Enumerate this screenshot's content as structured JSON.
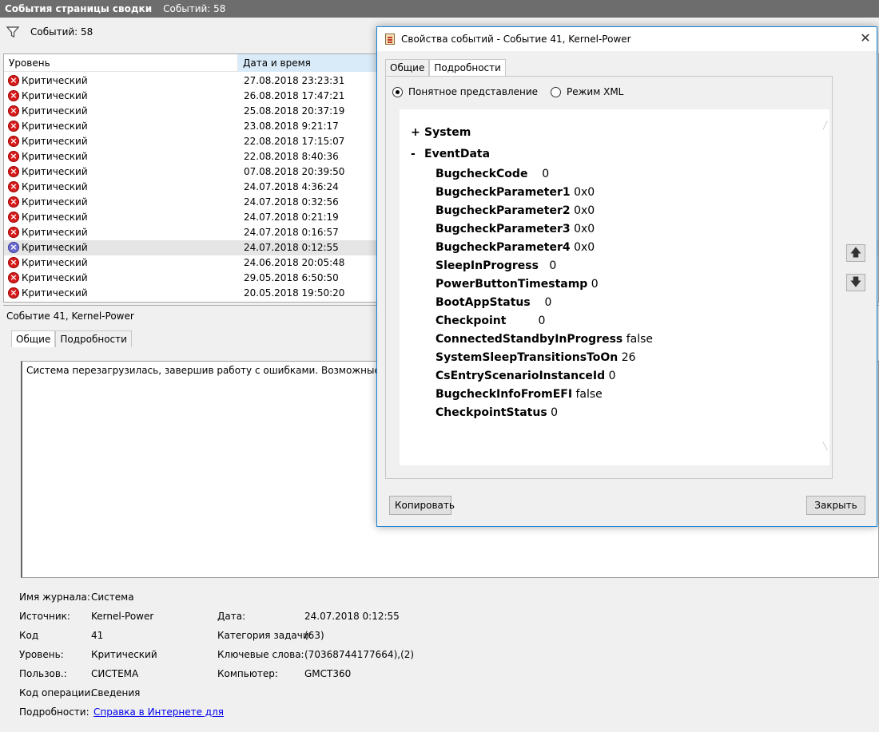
{
  "topbar": {
    "title": "События страницы сводки",
    "count": "Событий: 58"
  },
  "filter": {
    "count": "Событий: 58"
  },
  "table": {
    "columns": {
      "level": "Уровень",
      "date": "Дата и время"
    },
    "rows": [
      {
        "level": "Критический",
        "date": "27.08.2018 23:23:31"
      },
      {
        "level": "Критический",
        "date": "26.08.2018 17:47:21"
      },
      {
        "level": "Критический",
        "date": "25.08.2018 20:37:19"
      },
      {
        "level": "Критический",
        "date": "23.08.2018 9:21:17"
      },
      {
        "level": "Критический",
        "date": "22.08.2018 17:15:07"
      },
      {
        "level": "Критический",
        "date": "22.08.2018 8:40:36"
      },
      {
        "level": "Критический",
        "date": "07.08.2018 20:39:50"
      },
      {
        "level": "Критический",
        "date": "24.07.2018 4:36:24"
      },
      {
        "level": "Критический",
        "date": "24.07.2018 0:32:56"
      },
      {
        "level": "Критический",
        "date": "24.07.2018 0:21:19"
      },
      {
        "level": "Критический",
        "date": "24.07.2018 0:16:57"
      },
      {
        "level": "Критический",
        "date": "24.07.2018 0:12:55",
        "selected": true
      },
      {
        "level": "Критический",
        "date": "24.06.2018 20:05:48"
      },
      {
        "level": "Критический",
        "date": "29.05.2018 6:50:50"
      },
      {
        "level": "Критический",
        "date": "20.05.2018 19:50:20"
      }
    ]
  },
  "lower": {
    "event_header": "Событие 41, Kernel-Power",
    "tabs": {
      "general": "Общие",
      "details": "Подробности"
    },
    "description": "Система перезагрузилась, завершив работу с ошибками. Возможные причины",
    "props": {
      "log_label": "Имя журнала:",
      "log_value": "Система",
      "source_label": "Источник:",
      "source_value": "Kernel-Power",
      "date_label": "Дата:",
      "date_value": "24.07.2018 0:12:55",
      "code_label": "Код",
      "code_value": "41",
      "category_label": "Категория задачи:",
      "category_value": "(63)",
      "level_label": "Уровень:",
      "level_value": "Критический",
      "keywords_label": "Ключевые слова:",
      "keywords_value": "(70368744177664),(2)",
      "user_label": "Пользов.:",
      "user_value": "СИСТЕМА",
      "computer_label": "Компьютер:",
      "computer_value": "GMCT360",
      "opcode_label": "Код операции:",
      "opcode_value": "Сведения",
      "details_label": "Подробности:",
      "details_link": "Справка в Интернете для"
    }
  },
  "dialog": {
    "title": "Свойства событий - Событие 41, Kernel-Power",
    "close_glyph": "✕",
    "tabs": {
      "general": "Общие",
      "details": "Подробности"
    },
    "radio_friendly": "Понятное представление",
    "radio_xml": "Режим XML",
    "tree": {
      "system": {
        "sign": "+",
        "label": "System"
      },
      "eventdata": {
        "sign": "-",
        "label": "EventData"
      },
      "items": [
        {
          "key": "BugcheckCode",
          "value": "0"
        },
        {
          "key": "BugcheckParameter1",
          "value": "0x0"
        },
        {
          "key": "BugcheckParameter2",
          "value": "0x0"
        },
        {
          "key": "BugcheckParameter3",
          "value": "0x0"
        },
        {
          "key": "BugcheckParameter4",
          "value": "0x0"
        },
        {
          "key": "SleepInProgress",
          "value": "0"
        },
        {
          "key": "PowerButtonTimestamp",
          "value": "0"
        },
        {
          "key": "BootAppStatus",
          "value": "0"
        },
        {
          "key": "Checkpoint",
          "value": "0"
        },
        {
          "key": "ConnectedStandbyInProgress",
          "value": "false"
        },
        {
          "key": "SystemSleepTransitionsToOn",
          "value": "26"
        },
        {
          "key": "CsEntryScenarioInstanceId",
          "value": "0"
        },
        {
          "key": "BugcheckInfoFromEFI",
          "value": "false"
        },
        {
          "key": "CheckpointStatus",
          "value": "0"
        }
      ]
    },
    "copy_button": "Копировать",
    "close_button": "Закрыть",
    "up_arrow": "🡅",
    "down_arrow": "🡇"
  },
  "icons": {
    "critical": "critical-error-icon",
    "filter": "filter-icon"
  }
}
